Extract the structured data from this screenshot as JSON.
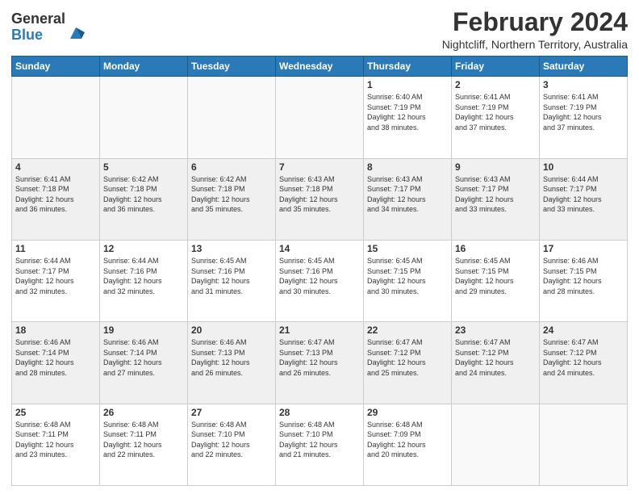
{
  "logo": {
    "general": "General",
    "blue": "Blue"
  },
  "title": "February 2024",
  "subtitle": "Nightcliff, Northern Territory, Australia",
  "days_header": [
    "Sunday",
    "Monday",
    "Tuesday",
    "Wednesday",
    "Thursday",
    "Friday",
    "Saturday"
  ],
  "weeks": [
    [
      {
        "day": "",
        "info": ""
      },
      {
        "day": "",
        "info": ""
      },
      {
        "day": "",
        "info": ""
      },
      {
        "day": "",
        "info": ""
      },
      {
        "day": "1",
        "info": "Sunrise: 6:40 AM\nSunset: 7:19 PM\nDaylight: 12 hours\nand 38 minutes."
      },
      {
        "day": "2",
        "info": "Sunrise: 6:41 AM\nSunset: 7:19 PM\nDaylight: 12 hours\nand 37 minutes."
      },
      {
        "day": "3",
        "info": "Sunrise: 6:41 AM\nSunset: 7:19 PM\nDaylight: 12 hours\nand 37 minutes."
      }
    ],
    [
      {
        "day": "4",
        "info": "Sunrise: 6:41 AM\nSunset: 7:18 PM\nDaylight: 12 hours\nand 36 minutes."
      },
      {
        "day": "5",
        "info": "Sunrise: 6:42 AM\nSunset: 7:18 PM\nDaylight: 12 hours\nand 36 minutes."
      },
      {
        "day": "6",
        "info": "Sunrise: 6:42 AM\nSunset: 7:18 PM\nDaylight: 12 hours\nand 35 minutes."
      },
      {
        "day": "7",
        "info": "Sunrise: 6:43 AM\nSunset: 7:18 PM\nDaylight: 12 hours\nand 35 minutes."
      },
      {
        "day": "8",
        "info": "Sunrise: 6:43 AM\nSunset: 7:17 PM\nDaylight: 12 hours\nand 34 minutes."
      },
      {
        "day": "9",
        "info": "Sunrise: 6:43 AM\nSunset: 7:17 PM\nDaylight: 12 hours\nand 33 minutes."
      },
      {
        "day": "10",
        "info": "Sunrise: 6:44 AM\nSunset: 7:17 PM\nDaylight: 12 hours\nand 33 minutes."
      }
    ],
    [
      {
        "day": "11",
        "info": "Sunrise: 6:44 AM\nSunset: 7:17 PM\nDaylight: 12 hours\nand 32 minutes."
      },
      {
        "day": "12",
        "info": "Sunrise: 6:44 AM\nSunset: 7:16 PM\nDaylight: 12 hours\nand 32 minutes."
      },
      {
        "day": "13",
        "info": "Sunrise: 6:45 AM\nSunset: 7:16 PM\nDaylight: 12 hours\nand 31 minutes."
      },
      {
        "day": "14",
        "info": "Sunrise: 6:45 AM\nSunset: 7:16 PM\nDaylight: 12 hours\nand 30 minutes."
      },
      {
        "day": "15",
        "info": "Sunrise: 6:45 AM\nSunset: 7:15 PM\nDaylight: 12 hours\nand 30 minutes."
      },
      {
        "day": "16",
        "info": "Sunrise: 6:45 AM\nSunset: 7:15 PM\nDaylight: 12 hours\nand 29 minutes."
      },
      {
        "day": "17",
        "info": "Sunrise: 6:46 AM\nSunset: 7:15 PM\nDaylight: 12 hours\nand 28 minutes."
      }
    ],
    [
      {
        "day": "18",
        "info": "Sunrise: 6:46 AM\nSunset: 7:14 PM\nDaylight: 12 hours\nand 28 minutes."
      },
      {
        "day": "19",
        "info": "Sunrise: 6:46 AM\nSunset: 7:14 PM\nDaylight: 12 hours\nand 27 minutes."
      },
      {
        "day": "20",
        "info": "Sunrise: 6:46 AM\nSunset: 7:13 PM\nDaylight: 12 hours\nand 26 minutes."
      },
      {
        "day": "21",
        "info": "Sunrise: 6:47 AM\nSunset: 7:13 PM\nDaylight: 12 hours\nand 26 minutes."
      },
      {
        "day": "22",
        "info": "Sunrise: 6:47 AM\nSunset: 7:12 PM\nDaylight: 12 hours\nand 25 minutes."
      },
      {
        "day": "23",
        "info": "Sunrise: 6:47 AM\nSunset: 7:12 PM\nDaylight: 12 hours\nand 24 minutes."
      },
      {
        "day": "24",
        "info": "Sunrise: 6:47 AM\nSunset: 7:12 PM\nDaylight: 12 hours\nand 24 minutes."
      }
    ],
    [
      {
        "day": "25",
        "info": "Sunrise: 6:48 AM\nSunset: 7:11 PM\nDaylight: 12 hours\nand 23 minutes."
      },
      {
        "day": "26",
        "info": "Sunrise: 6:48 AM\nSunset: 7:11 PM\nDaylight: 12 hours\nand 22 minutes."
      },
      {
        "day": "27",
        "info": "Sunrise: 6:48 AM\nSunset: 7:10 PM\nDaylight: 12 hours\nand 22 minutes."
      },
      {
        "day": "28",
        "info": "Sunrise: 6:48 AM\nSunset: 7:10 PM\nDaylight: 12 hours\nand 21 minutes."
      },
      {
        "day": "29",
        "info": "Sunrise: 6:48 AM\nSunset: 7:09 PM\nDaylight: 12 hours\nand 20 minutes."
      },
      {
        "day": "",
        "info": ""
      },
      {
        "day": "",
        "info": ""
      }
    ]
  ]
}
